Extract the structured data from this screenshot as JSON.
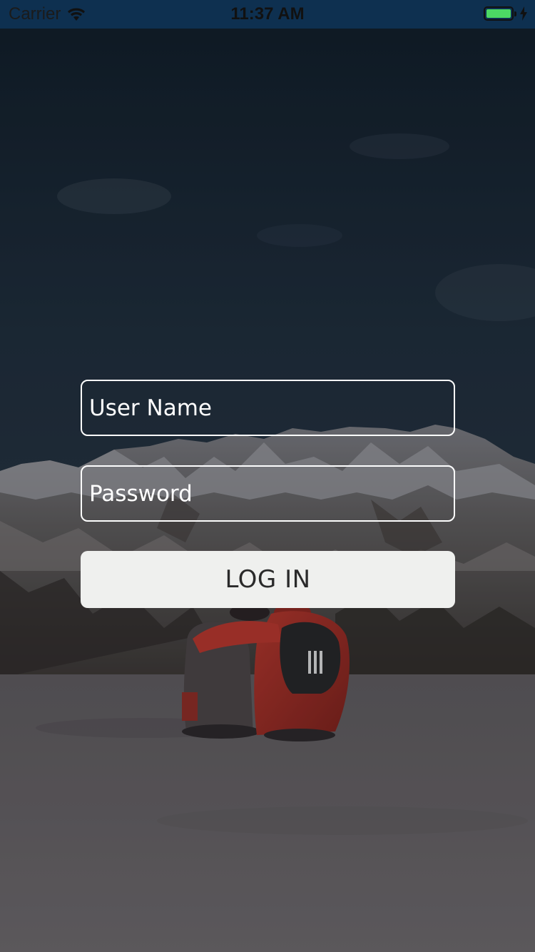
{
  "status_bar": {
    "carrier": "Carrier",
    "time": "11:37 AM",
    "battery_icon": "battery-full-charging-icon",
    "signal_icon": "wifi-icon"
  },
  "login_form": {
    "username_placeholder": "User Name",
    "password_placeholder": "Password",
    "login_label": "LOG IN"
  },
  "colors": {
    "button_bg": "#eff0ee",
    "field_border": "#ffffff",
    "battery_fill": "#4cd964"
  }
}
